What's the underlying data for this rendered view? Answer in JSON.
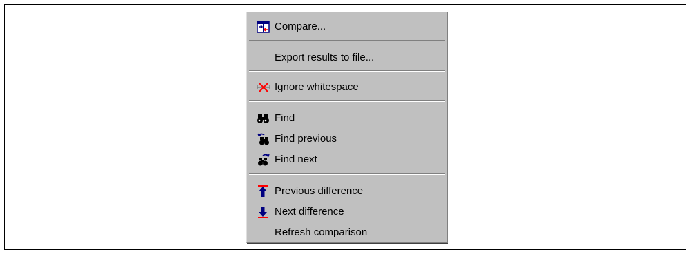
{
  "context_menu": {
    "items": [
      {
        "label": "Compare...",
        "icon": "compare-icon"
      },
      {
        "label": "Export results to file...",
        "icon": null
      },
      {
        "label": "Ignore whitespace",
        "icon": "ignore-whitespace-icon"
      },
      {
        "label": "Find",
        "icon": "binoculars-icon"
      },
      {
        "label": "Find previous",
        "icon": "find-previous-icon"
      },
      {
        "label": "Find next",
        "icon": "find-next-icon"
      },
      {
        "label": "Previous difference",
        "icon": "arrow-up-icon"
      },
      {
        "label": "Next difference",
        "icon": "arrow-down-icon"
      },
      {
        "label": "Refresh comparison",
        "icon": null
      }
    ]
  },
  "colors": {
    "menu_background": "#c0c0c0",
    "icon_blue": "#000080",
    "icon_red": "#ff0000"
  }
}
